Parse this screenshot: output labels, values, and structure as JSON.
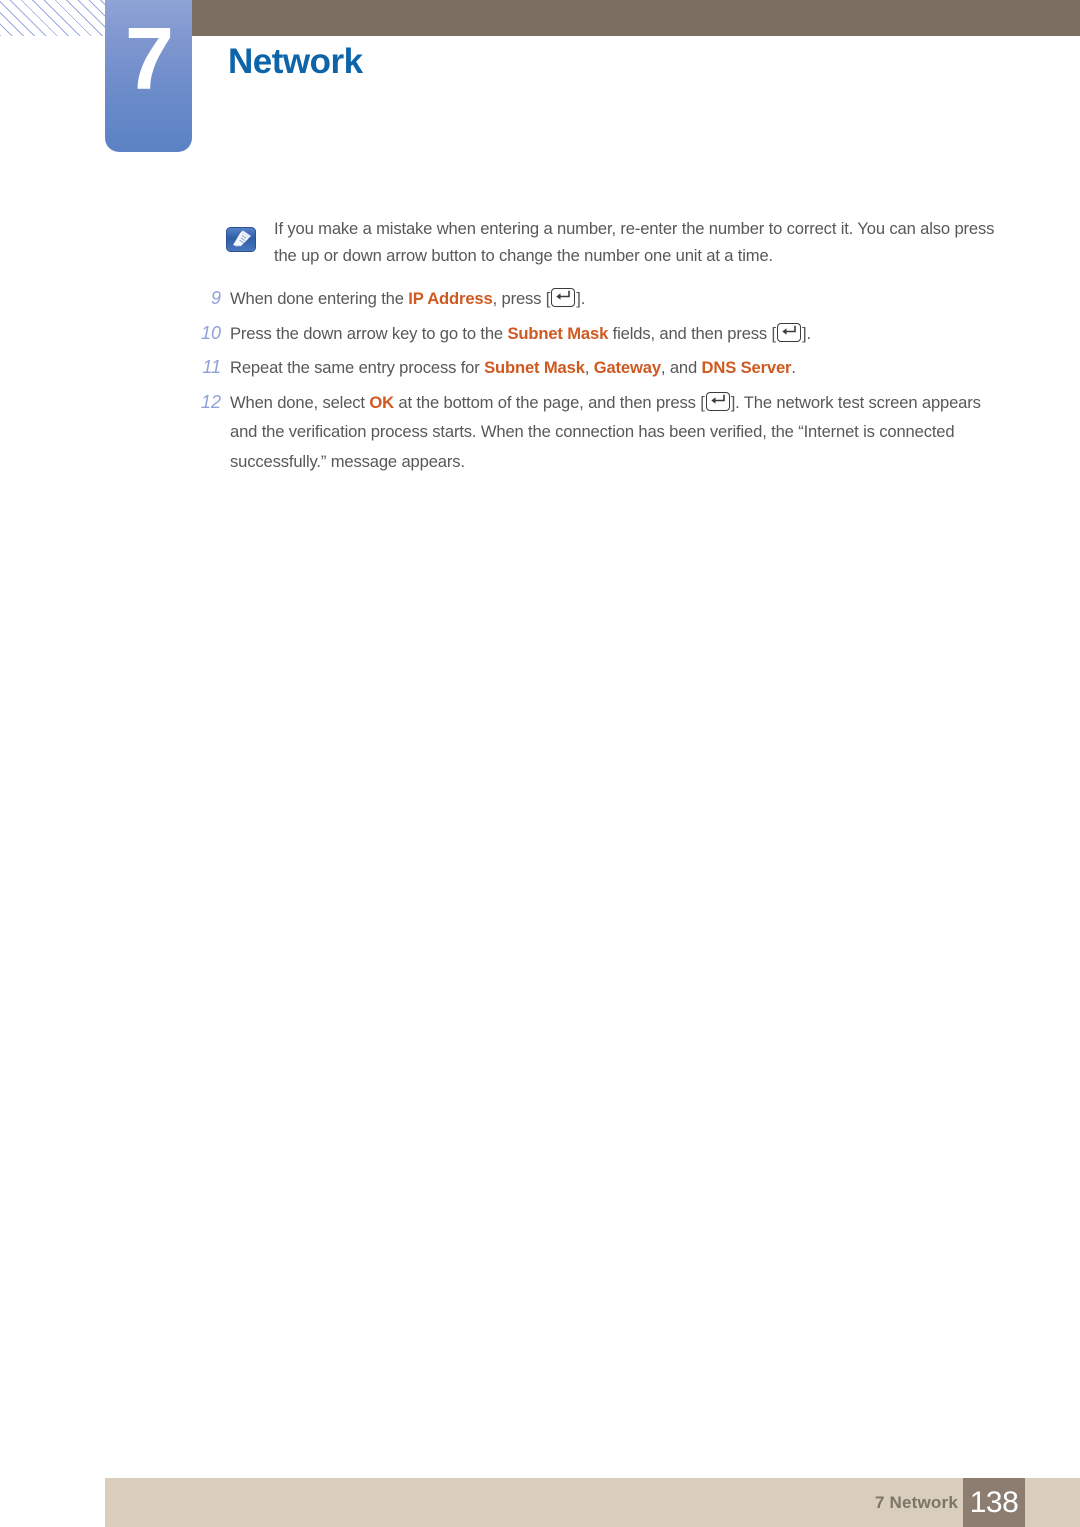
{
  "header": {
    "chapter_number": "7",
    "chapter_title": "Network",
    "badge_color_top": "#8fa3d6",
    "badge_color_bottom": "#5b82c4",
    "bar_color": "#7d6e62",
    "title_color": "#0d64a9"
  },
  "note": {
    "icon": "note-pencil-icon",
    "line1": "If you make a mistake when entering a number, re-enter the number to correct it. You can also",
    "line2": "press the up or down arrow button to change the number one unit at a time."
  },
  "steps": [
    {
      "number": "9",
      "parts": [
        {
          "type": "text",
          "value": "When done entering the "
        },
        {
          "type": "keyword",
          "value": "IP Address"
        },
        {
          "type": "text",
          "value": ", press ["
        },
        {
          "type": "icon",
          "value": "enter-key-icon"
        },
        {
          "type": "text",
          "value": "]."
        }
      ]
    },
    {
      "number": "10",
      "parts": [
        {
          "type": "text",
          "value": "Press the down arrow key to go to the "
        },
        {
          "type": "keyword",
          "value": "Subnet Mask"
        },
        {
          "type": "text",
          "value": " fields, and then press ["
        },
        {
          "type": "icon",
          "value": "enter-key-icon"
        },
        {
          "type": "text",
          "value": "]."
        }
      ]
    },
    {
      "number": "11",
      "parts": [
        {
          "type": "text",
          "value": "Repeat the same entry process for "
        },
        {
          "type": "keyword",
          "value": "Subnet Mask"
        },
        {
          "type": "text",
          "value": ", "
        },
        {
          "type": "keyword",
          "value": "Gateway"
        },
        {
          "type": "text",
          "value": ", and "
        },
        {
          "type": "keyword",
          "value": "DNS Server"
        },
        {
          "type": "text",
          "value": "."
        }
      ]
    },
    {
      "number": "12",
      "parts": [
        {
          "type": "text",
          "value": "When done, select "
        },
        {
          "type": "keyword",
          "value": "OK"
        },
        {
          "type": "text",
          "value": " at the bottom of the page, and then press ["
        },
        {
          "type": "icon",
          "value": "enter-key-icon"
        },
        {
          "type": "text",
          "value": "]. The network test screen appears and the verification process starts. When the connection has been verified, the “Internet is connected successfully.” message appears."
        }
      ]
    }
  ],
  "footer": {
    "label": "7 Network",
    "page_number": "138",
    "bar_color": "#d9cdbc",
    "page_box_color": "#8d7d71"
  },
  "colors": {
    "keyword_orange": "#cf5a21",
    "body_gray": "#58585a",
    "step_number_blue": "#8fa0d9"
  }
}
